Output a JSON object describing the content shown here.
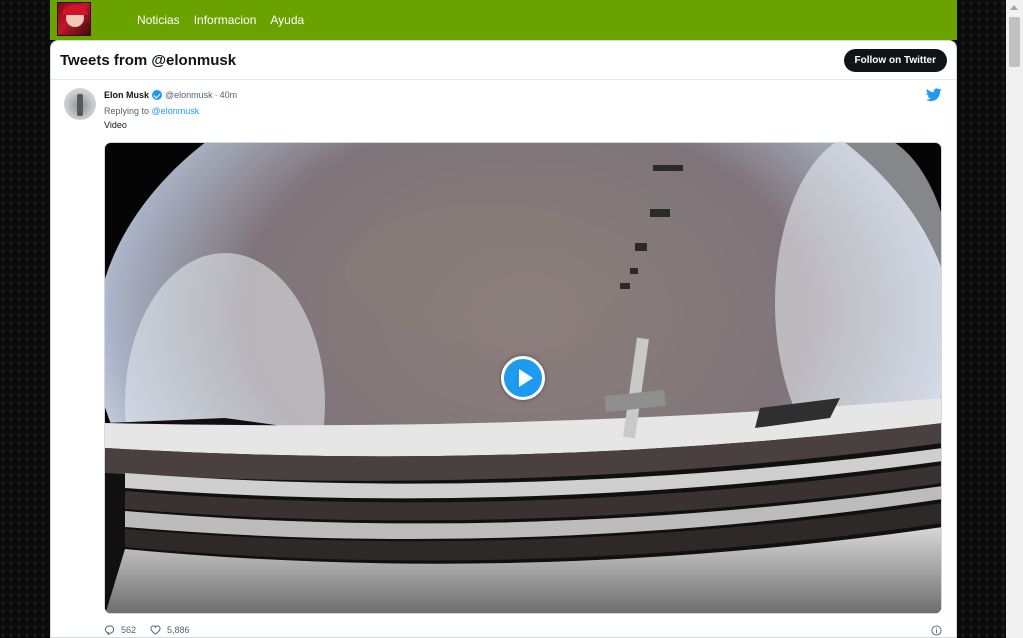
{
  "nav": {
    "items": [
      {
        "label": "Noticias"
      },
      {
        "label": "Informacion"
      },
      {
        "label": "Ayuda"
      }
    ]
  },
  "widget": {
    "title": "Tweets from @elonmusk",
    "follow_label": "Follow on Twitter"
  },
  "tweet": {
    "author_name": "Elon Musk",
    "handle": "@elonmusk",
    "separator": "·",
    "time": "40m",
    "reply_prefix": "Replying to",
    "reply_handle": "@elonmusk",
    "text": "Video",
    "media_type": "video",
    "replies": "562",
    "likes": "5,886"
  },
  "colors": {
    "nav_bg": "#6aa300",
    "twitter_blue": "#1d9bf0",
    "follow_btn_bg": "#0f1419"
  },
  "icons": [
    "site-logo",
    "verified-badge-icon",
    "twitter-bird-icon",
    "play-icon",
    "reply-icon",
    "heart-icon",
    "info-icon"
  ]
}
